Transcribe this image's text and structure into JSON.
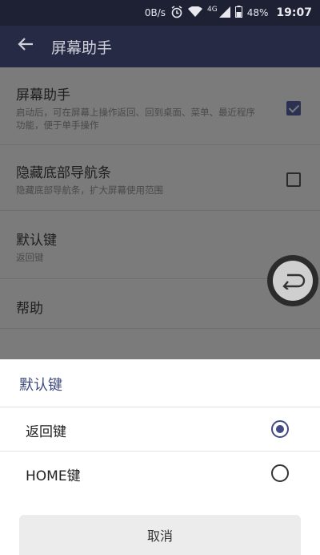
{
  "status_bar": {
    "net_speed": "0B/s",
    "network_type": "4G",
    "battery": "48%",
    "time": "19:07",
    "icons": [
      "alarm-icon",
      "wifi-icon",
      "signal-icon",
      "battery-icon"
    ]
  },
  "app_bar": {
    "title": "屏幕助手",
    "back_icon": "arrow-left-icon"
  },
  "settings": [
    {
      "title": "屏幕助手",
      "subtitle": "启动后，可在屏幕上操作返回、回到桌面、菜单、最近程序功能，便于单手操作",
      "checked": true
    },
    {
      "title": "隐藏底部导航条",
      "subtitle": "隐藏底部导航条，扩大屏幕使用范围",
      "checked": false
    },
    {
      "title": "默认键",
      "subtitle": "返回键"
    },
    {
      "title": "帮助"
    }
  ],
  "floating_button": {
    "icon": "back-return-icon"
  },
  "dialog": {
    "title": "默认键",
    "options": [
      {
        "label": "返回键",
        "selected": true
      },
      {
        "label": "HOME键",
        "selected": false
      }
    ],
    "cancel_label": "取消"
  },
  "colors": {
    "accent": "#434a86",
    "app_bar": "#262a44",
    "status_bar": "#1d2133"
  }
}
